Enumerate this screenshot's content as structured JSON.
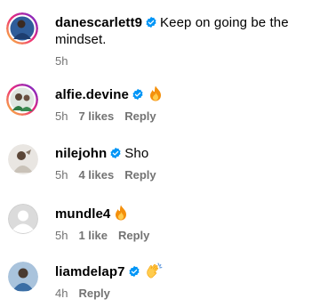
{
  "comments": [
    {
      "username": "danescarlett9",
      "verified": true,
      "text": "Keep on going be the mindset.",
      "time": "5h",
      "likes": "",
      "reply": ""
    },
    {
      "username": "alfie.devine",
      "verified": true,
      "text": "",
      "emoji": "fire-icon",
      "time": "5h",
      "likes": "7 likes",
      "reply": "Reply"
    },
    {
      "username": "nilejohn",
      "verified": true,
      "text": "Sho",
      "time": "5h",
      "likes": "4 likes",
      "reply": "Reply"
    },
    {
      "username": "mundle4",
      "verified": false,
      "text": "",
      "emoji": "fire-icon",
      "time": "5h",
      "likes": "1 like",
      "reply": "Reply"
    },
    {
      "username": "liamdelap7",
      "verified": true,
      "text": "",
      "emoji": "clapping-hands-icon",
      "time": "4h",
      "likes": "",
      "reply": "Reply"
    }
  ],
  "colors": {
    "verified_blue": "#0095f6",
    "meta_gray": "#737373",
    "story_ring_start": "#f9ce34",
    "story_ring_mid": "#ee2a7b",
    "story_ring_end": "#6228d7"
  }
}
